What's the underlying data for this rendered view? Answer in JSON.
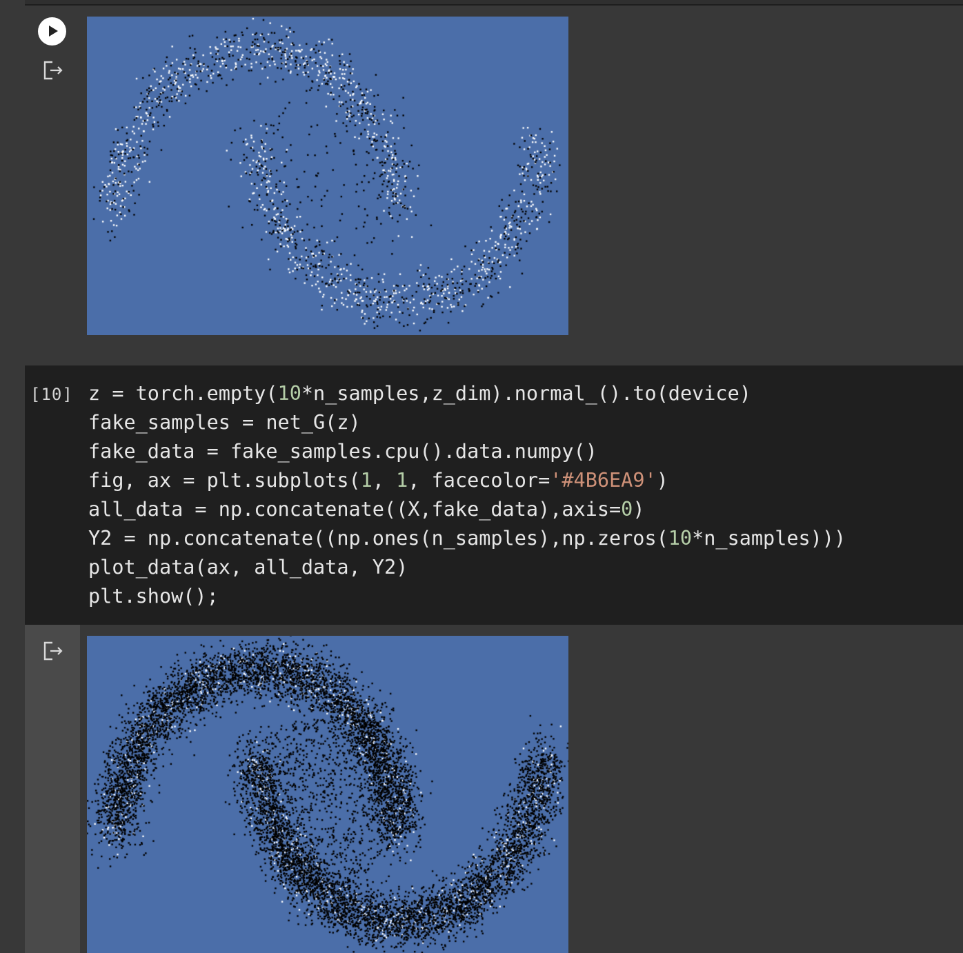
{
  "cell_prev": {
    "run_button": "run-cell",
    "output_icon": "output-redirect-icon"
  },
  "code_cell": {
    "execution_count": "[10]",
    "lines": [
      [
        {
          "t": "z = torch.empty("
        },
        {
          "t": "10",
          "c": "num"
        },
        {
          "t": "*n_samples,z_dim).normal_().to(device)"
        }
      ],
      [
        {
          "t": "fake_samples = net_G(z)"
        }
      ],
      [
        {
          "t": "fake_data = fake_samples.cpu().data.numpy()"
        }
      ],
      [
        {
          "t": "fig, ax = plt.subplots("
        },
        {
          "t": "1",
          "c": "num"
        },
        {
          "t": ", "
        },
        {
          "t": "1",
          "c": "num"
        },
        {
          "t": ", facecolor="
        },
        {
          "t": "'#4B6EA9'",
          "c": "str"
        },
        {
          "t": ")"
        }
      ],
      [
        {
          "t": "all_data = np.concatenate((X,fake_data),axis="
        },
        {
          "t": "0",
          "c": "num"
        },
        {
          "t": ")"
        }
      ],
      [
        {
          "t": "Y2 = np.concatenate((np.ones(n_samples),np.zeros("
        },
        {
          "t": "10",
          "c": "num"
        },
        {
          "t": "*n_samples)))"
        }
      ],
      [
        {
          "t": "plot_data(ax, all_data, Y2)"
        }
      ],
      [
        {
          "t": "plt.show();"
        }
      ]
    ]
  },
  "plots": {
    "facecolor": "#4B6EA9",
    "real_color": "#ffffff",
    "fake_color": "#000000"
  },
  "chart_data": [
    {
      "type": "scatter",
      "series": [
        {
          "color": "#ffffff",
          "description": "real two-moons samples"
        },
        {
          "color": "#000000",
          "description": "generated samples"
        }
      ],
      "x_range": [
        -1.2,
        2.2
      ],
      "y_range": [
        -0.7,
        1.2
      ],
      "grid": false,
      "axes_visible": false
    },
    {
      "type": "scatter",
      "series": [
        {
          "color": "#ffffff",
          "description": "real two-moons samples"
        },
        {
          "color": "#000000",
          "description": "generated samples (10x n_samples)"
        }
      ],
      "x_range": [
        -1.2,
        2.2
      ],
      "y_range": [
        -0.7,
        1.2
      ],
      "grid": false,
      "axes_visible": false
    }
  ]
}
